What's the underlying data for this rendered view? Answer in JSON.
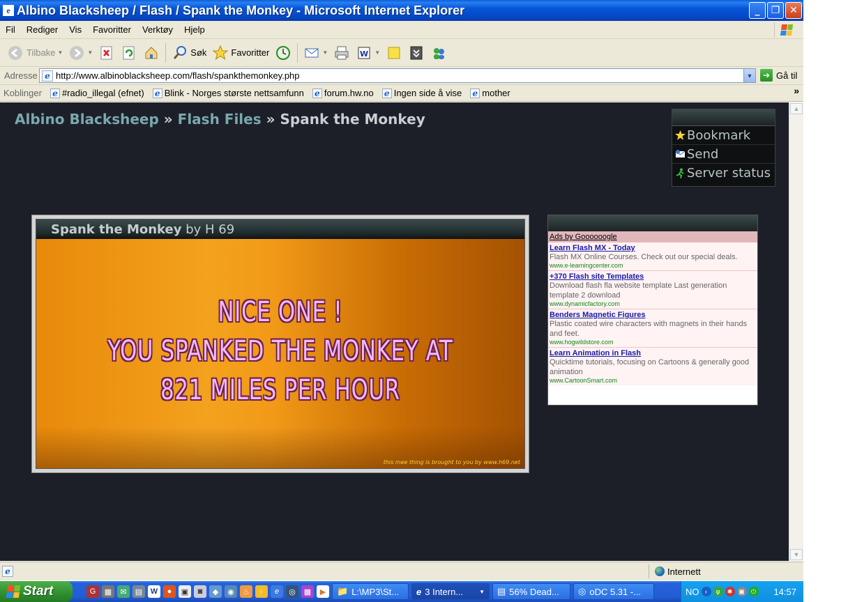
{
  "window": {
    "title": "Albino Blacksheep / Flash / Spank the Monkey - Microsoft Internet Explorer"
  },
  "menubar": [
    {
      "label": "Fil"
    },
    {
      "label": "Rediger"
    },
    {
      "label": "Vis"
    },
    {
      "label": "Favoritter"
    },
    {
      "label": "Verktøy"
    },
    {
      "label": "Hjelp"
    }
  ],
  "toolbar": {
    "back_label": "Tilbake",
    "search_label": "Søk",
    "favorites_label": "Favoritter"
  },
  "addressbar": {
    "label": "Adresse",
    "url": "http://www.albinoblacksheep.com/flash/spankthemonkey.php",
    "go_label": "Gå til"
  },
  "linksbar": {
    "label": "Koblinger",
    "links": [
      {
        "label": "#radio_illegal (efnet)"
      },
      {
        "label": "Blink - Norges største nettsamfunn"
      },
      {
        "label": "forum.hw.no"
      },
      {
        "label": "Ingen side å vise"
      },
      {
        "label": "mother"
      }
    ],
    "more": "»"
  },
  "page": {
    "breadcrumb": {
      "site": "Albino Blacksheep",
      "sep1": " » ",
      "section": "Flash Files",
      "sep2": " » ",
      "current": "Spank the Monkey"
    },
    "sidebox": [
      {
        "label": "Bookmark",
        "icon": "star-icon"
      },
      {
        "label": "Send",
        "icon": "send-icon"
      },
      {
        "label": "Server status",
        "icon": "runner-icon"
      }
    ],
    "flash": {
      "title": "Spank the Monkey",
      "author": "by H 69",
      "lines": [
        "NICE ONE !",
        "YOU SPANKED THE MONKEY AT",
        "821 MILES PER HOUR"
      ],
      "credit": "this mee thing is brought to you by www.h69.net"
    },
    "ads": {
      "title": "Ads by Goooooogle",
      "items": [
        {
          "headline": "Learn Flash MX - Today",
          "desc": "Flash MX Online Courses. Check out our special deals.",
          "url": "www.e-learningcenter.com"
        },
        {
          "headline": "+370 Flash site Templates",
          "desc": "Download flash fla website template Last generation template 2 download",
          "url": "www.dynamicfactory.com"
        },
        {
          "headline": "Benders Magnetic Figures",
          "desc": "Plastic coated wire characters with magnets in their hands and feet.",
          "url": "www.hogwildstore.com"
        },
        {
          "headline": "Learn Animation in Flash",
          "desc": "Quicktime tutorials, focusing on Cartoons & generally good animation",
          "url": "www.CartoonSmart.com"
        }
      ]
    }
  },
  "statusbar": {
    "zone": "Internett"
  },
  "taskbar": {
    "start": "Start",
    "tasks": [
      {
        "label": "L:\\MP3\\St..."
      },
      {
        "label": "3 Intern..."
      },
      {
        "label": "56% Dead..."
      },
      {
        "label": "oDC 5.31 -..."
      }
    ],
    "lang": "NO",
    "clock": "14:57"
  },
  "colors": {
    "page_bg": "#1d1f28",
    "breadcrumb_link": "#79a9ad",
    "flash_orange": "#f3a21e",
    "game_text": "#f3b8f5",
    "ad_headline": "#1a1aa6",
    "ad_url": "#118811"
  }
}
